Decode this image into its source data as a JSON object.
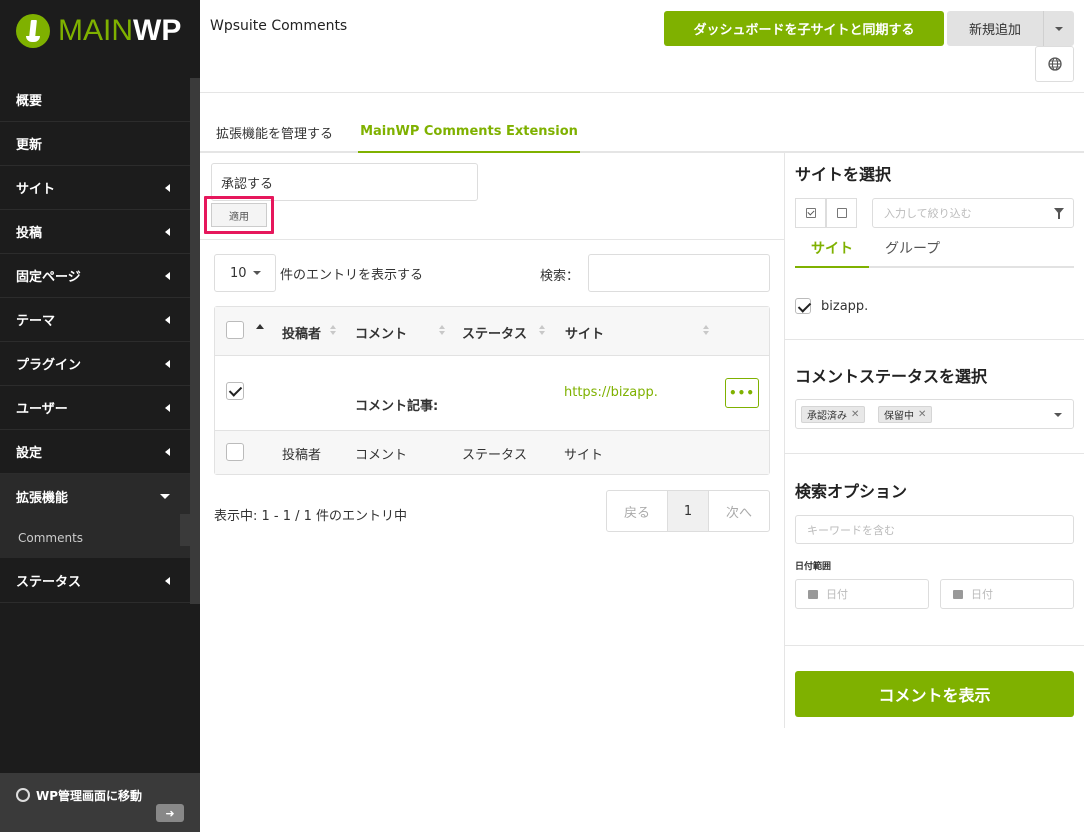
{
  "brand": {
    "name_part1": "MAIN",
    "name_part2": "WP"
  },
  "sidebar": {
    "items": [
      {
        "label": "概要"
      },
      {
        "label": "更新"
      },
      {
        "label": "サイト"
      },
      {
        "label": "投稿"
      },
      {
        "label": "固定ページ"
      },
      {
        "label": "テーマ"
      },
      {
        "label": "プラグイン"
      },
      {
        "label": "ユーザー"
      },
      {
        "label": "設定"
      },
      {
        "label": "拡張機能"
      },
      {
        "label": "ステータス"
      }
    ],
    "sub_item": "Comments",
    "wp_admin_label": "WP管理画面に移動"
  },
  "header": {
    "title": "Wpsuite Comments",
    "sync_button": "ダッシュボードを子サイトと同期する",
    "new_button": "新規追加"
  },
  "tabs": {
    "manage": "拡張機能を管理する",
    "extension": "MainWP Comments Extension"
  },
  "bulk": {
    "action": "承認する",
    "apply": "適用"
  },
  "table_controls": {
    "length_value": "10",
    "length_text": "件のエントリを表示する",
    "search_label": "検索："
  },
  "table": {
    "columns": [
      "投稿者",
      "コメント",
      "ステータス",
      "サイト"
    ],
    "rows": [
      {
        "author": "",
        "comment": "コメント記事:",
        "status": "",
        "site": "https://bizapp.",
        "more": "•••"
      }
    ]
  },
  "pagination": {
    "info": "表示中: 1 - 1 / 1 件のエントリ中",
    "prev": "戻る",
    "page": "1",
    "next": "次へ"
  },
  "right": {
    "select_site_title": "サイトを選択",
    "filter_placeholder": "入力して絞り込む",
    "tab_site": "サイト",
    "tab_group": "グループ",
    "site_name": "bizapp.",
    "status_title": "コメントステータスを選択",
    "chips": [
      "承認済み",
      "保留中"
    ],
    "search_title": "検索オプション",
    "keyword_placeholder": "キーワードを含む",
    "date_range_label": "日付範囲",
    "date_placeholder": "日付",
    "show_button": "コメントを表示"
  },
  "colors": {
    "accent": "#7fb100",
    "sidebar_bg": "#1c1c1c",
    "highlight": "#e6175c"
  }
}
